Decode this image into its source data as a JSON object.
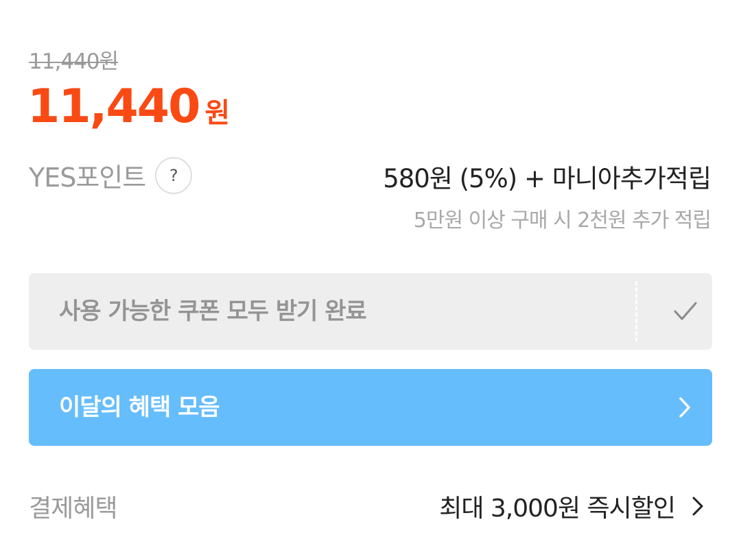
{
  "price": {
    "original": "11,440원",
    "sale_amount": "11,440",
    "sale_unit": "원"
  },
  "points": {
    "label": "YES포인트",
    "help_icon_text": "?",
    "value": "580원 (5%) + 마니아추가적립",
    "note": "5만원 이상 구매 시 2천원 추가 적립"
  },
  "coupon": {
    "label": "사용 가능한 쿠폰 모두 받기 완료",
    "icon": "check-icon"
  },
  "monthly_benefits": {
    "label": "이달의 혜택 모음",
    "icon": "chevron-right-icon"
  },
  "payment_benefits": {
    "label": "결제혜택",
    "value": "최대 3,000원 즉시할인",
    "icon": "chevron-right-icon"
  },
  "colors": {
    "sale_price": "#fa4a14",
    "benefit_bar": "#66bdfc",
    "coupon_bar": "#eeeeee"
  }
}
